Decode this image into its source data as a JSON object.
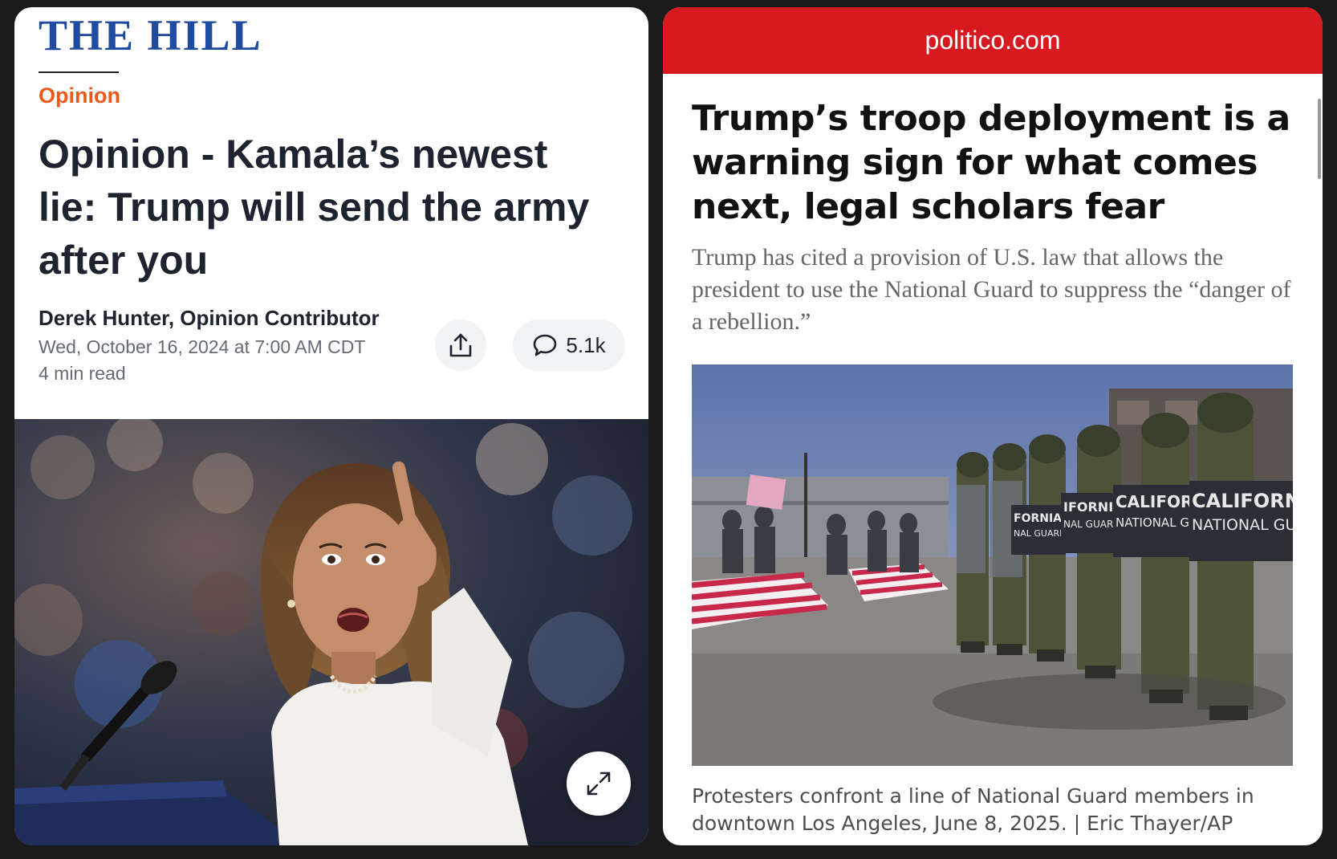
{
  "left_article": {
    "logo": "THE HILL",
    "section": "Opinion",
    "headline": "Opinion - Kamala’s newest lie: Trump will send the army after you",
    "author": "Derek Hunter, Opinion Contributor",
    "date": "Wed, October 16, 2024 at 7:00 AM CDT",
    "read_time": "4 min read",
    "comment_count": "5.1k",
    "icons": [
      "share-icon",
      "comment-icon",
      "expand-icon"
    ],
    "colors": {
      "logo": "#1f4ba0",
      "section": "#ea5b1b"
    }
  },
  "right_article": {
    "url": "politico.com",
    "headline": "Trump’s troop deployment is a warning sign for what comes next, legal scholars fear",
    "dek": "Trump has cited a provision of U.S. law that allows the president to use the National Guard to suppress the “danger of a rebellion.”",
    "caption": "Protesters confront a line of National Guard members in downtown Los Angeles, June 8, 2025. | Eric Thayer/AP",
    "photo_text": {
      "shield_front": "CALIFORNIA",
      "shield_front_2": "NATIONAL GUARD",
      "shield_second": "CALIFORNI",
      "shield_second_2": "NATIONAL GUAR",
      "shield_third": "IFORNIA",
      "shield_third_2": "NAL GUARD",
      "shield_fourth": "FORNIA",
      "shield_fourth_2": "NAL GUARD"
    },
    "colors": {
      "bar": "#d71920"
    }
  }
}
